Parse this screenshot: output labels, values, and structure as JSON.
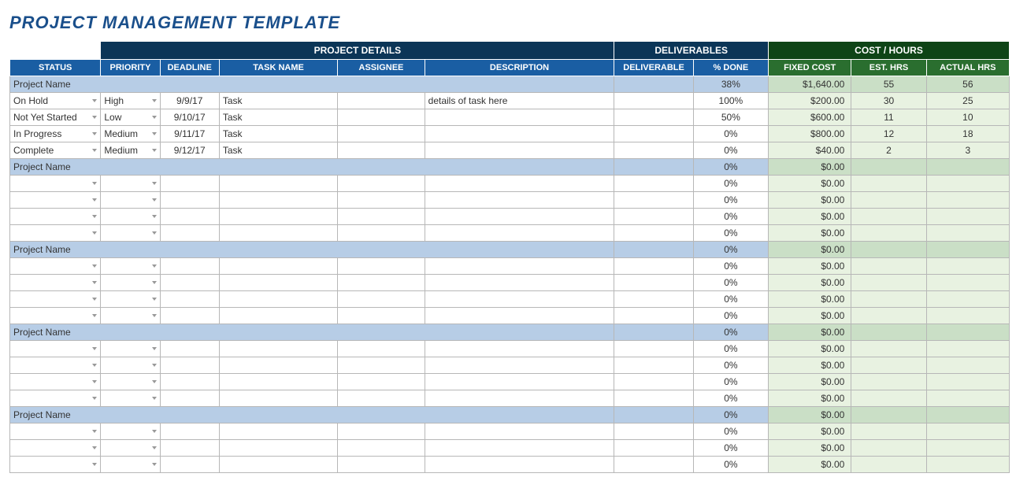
{
  "title": "PROJECT MANAGEMENT TEMPLATE",
  "sections": {
    "details": "PROJECT DETAILS",
    "deliverables": "DELIVERABLES",
    "cost": "COST / HOURS"
  },
  "headers": {
    "status": "STATUS",
    "priority": "PRIORITY",
    "deadline": "DEADLINE",
    "taskname": "TASK NAME",
    "assignee": "ASSIGNEE",
    "description": "DESCRIPTION",
    "deliverable": "DELIVERABLE",
    "done": "% DONE",
    "fixed": "FIXED COST",
    "est": "EST. HRS",
    "act": "ACTUAL HRS"
  },
  "groups": [
    {
      "name": "Project Name",
      "summary": {
        "done": "38%",
        "cost": "$1,640.00",
        "est": "55",
        "act": "56"
      },
      "rows": [
        {
          "status": "On Hold",
          "priority": "High",
          "deadline": "9/9/17",
          "task": "Task",
          "assignee": "",
          "desc": "details of task here",
          "deliv": "",
          "done": "100%",
          "cost": "$200.00",
          "est": "30",
          "act": "25"
        },
        {
          "status": "Not Yet Started",
          "priority": "Low",
          "deadline": "9/10/17",
          "task": "Task",
          "assignee": "",
          "desc": "",
          "deliv": "",
          "done": "50%",
          "cost": "$600.00",
          "est": "11",
          "act": "10"
        },
        {
          "status": "In Progress",
          "priority": "Medium",
          "deadline": "9/11/17",
          "task": "Task",
          "assignee": "",
          "desc": "",
          "deliv": "",
          "done": "0%",
          "cost": "$800.00",
          "est": "12",
          "act": "18"
        },
        {
          "status": "Complete",
          "priority": "Medium",
          "deadline": "9/12/17",
          "task": "Task",
          "assignee": "",
          "desc": "",
          "deliv": "",
          "done": "0%",
          "cost": "$40.00",
          "est": "2",
          "act": "3"
        }
      ]
    },
    {
      "name": "Project Name",
      "summary": {
        "done": "0%",
        "cost": "$0.00",
        "est": "",
        "act": ""
      },
      "rows": [
        {
          "status": "",
          "priority": "",
          "deadline": "",
          "task": "",
          "assignee": "",
          "desc": "",
          "deliv": "",
          "done": "0%",
          "cost": "$0.00",
          "est": "",
          "act": ""
        },
        {
          "status": "",
          "priority": "",
          "deadline": "",
          "task": "",
          "assignee": "",
          "desc": "",
          "deliv": "",
          "done": "0%",
          "cost": "$0.00",
          "est": "",
          "act": ""
        },
        {
          "status": "",
          "priority": "",
          "deadline": "",
          "task": "",
          "assignee": "",
          "desc": "",
          "deliv": "",
          "done": "0%",
          "cost": "$0.00",
          "est": "",
          "act": ""
        },
        {
          "status": "",
          "priority": "",
          "deadline": "",
          "task": "",
          "assignee": "",
          "desc": "",
          "deliv": "",
          "done": "0%",
          "cost": "$0.00",
          "est": "",
          "act": ""
        }
      ]
    },
    {
      "name": "Project Name",
      "summary": {
        "done": "0%",
        "cost": "$0.00",
        "est": "",
        "act": ""
      },
      "rows": [
        {
          "status": "",
          "priority": "",
          "deadline": "",
          "task": "",
          "assignee": "",
          "desc": "",
          "deliv": "",
          "done": "0%",
          "cost": "$0.00",
          "est": "",
          "act": ""
        },
        {
          "status": "",
          "priority": "",
          "deadline": "",
          "task": "",
          "assignee": "",
          "desc": "",
          "deliv": "",
          "done": "0%",
          "cost": "$0.00",
          "est": "",
          "act": ""
        },
        {
          "status": "",
          "priority": "",
          "deadline": "",
          "task": "",
          "assignee": "",
          "desc": "",
          "deliv": "",
          "done": "0%",
          "cost": "$0.00",
          "est": "",
          "act": ""
        },
        {
          "status": "",
          "priority": "",
          "deadline": "",
          "task": "",
          "assignee": "",
          "desc": "",
          "deliv": "",
          "done": "0%",
          "cost": "$0.00",
          "est": "",
          "act": ""
        }
      ]
    },
    {
      "name": "Project Name",
      "summary": {
        "done": "0%",
        "cost": "$0.00",
        "est": "",
        "act": ""
      },
      "rows": [
        {
          "status": "",
          "priority": "",
          "deadline": "",
          "task": "",
          "assignee": "",
          "desc": "",
          "deliv": "",
          "done": "0%",
          "cost": "$0.00",
          "est": "",
          "act": ""
        },
        {
          "status": "",
          "priority": "",
          "deadline": "",
          "task": "",
          "assignee": "",
          "desc": "",
          "deliv": "",
          "done": "0%",
          "cost": "$0.00",
          "est": "",
          "act": ""
        },
        {
          "status": "",
          "priority": "",
          "deadline": "",
          "task": "",
          "assignee": "",
          "desc": "",
          "deliv": "",
          "done": "0%",
          "cost": "$0.00",
          "est": "",
          "act": ""
        },
        {
          "status": "",
          "priority": "",
          "deadline": "",
          "task": "",
          "assignee": "",
          "desc": "",
          "deliv": "",
          "done": "0%",
          "cost": "$0.00",
          "est": "",
          "act": ""
        }
      ]
    },
    {
      "name": "Project Name",
      "summary": {
        "done": "0%",
        "cost": "$0.00",
        "est": "",
        "act": ""
      },
      "rows": [
        {
          "status": "",
          "priority": "",
          "deadline": "",
          "task": "",
          "assignee": "",
          "desc": "",
          "deliv": "",
          "done": "0%",
          "cost": "$0.00",
          "est": "",
          "act": ""
        },
        {
          "status": "",
          "priority": "",
          "deadline": "",
          "task": "",
          "assignee": "",
          "desc": "",
          "deliv": "",
          "done": "0%",
          "cost": "$0.00",
          "est": "",
          "act": ""
        },
        {
          "status": "",
          "priority": "",
          "deadline": "",
          "task": "",
          "assignee": "",
          "desc": "",
          "deliv": "",
          "done": "0%",
          "cost": "$0.00",
          "est": "",
          "act": ""
        }
      ]
    }
  ]
}
